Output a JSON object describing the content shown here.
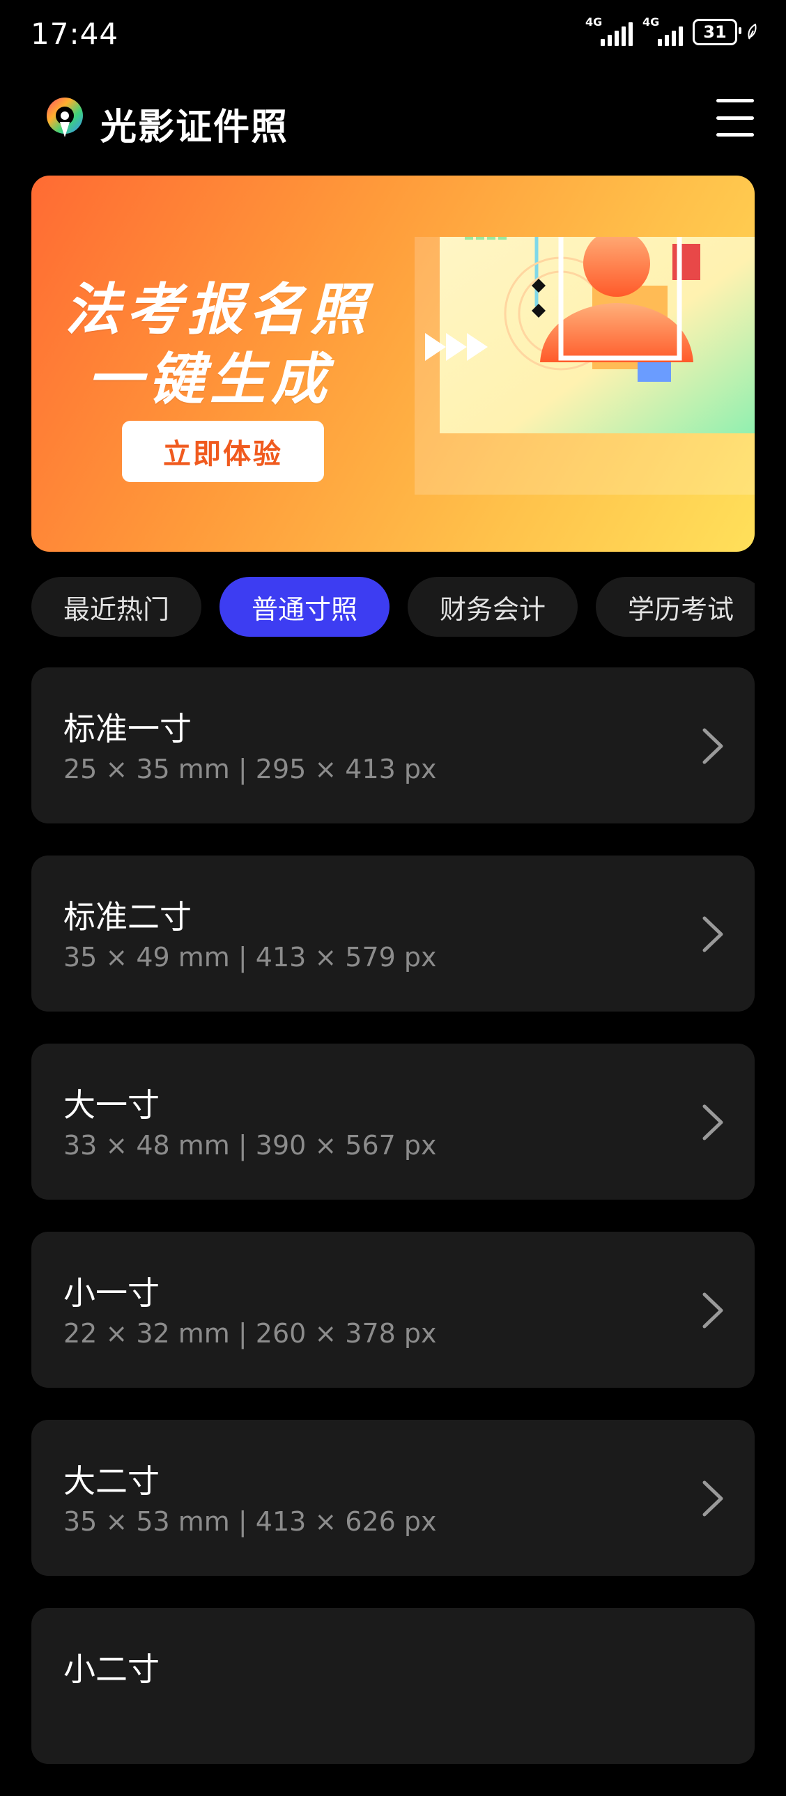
{
  "status": {
    "time": "17:44",
    "net1": "4G",
    "net2": "4G",
    "battery": "31"
  },
  "app": {
    "title": "光影证件照",
    "logo_icon": "aperture-pin-logo",
    "menu_icon": "hamburger-menu-icon"
  },
  "banner": {
    "line1": "法考报名照",
    "line2": "一键生成",
    "cta": "立即体验"
  },
  "tabs": [
    {
      "label": "最近热门",
      "active": false
    },
    {
      "label": "普通寸照",
      "active": true
    },
    {
      "label": "财务会计",
      "active": false
    },
    {
      "label": "学历考试",
      "active": false
    }
  ],
  "items": [
    {
      "title": "标准一寸",
      "spec": "25 × 35 mm | 295 × 413 px"
    },
    {
      "title": "标准二寸",
      "spec": "35 × 49 mm | 413 × 579 px"
    },
    {
      "title": "大一寸",
      "spec": "33 × 48 mm | 390 × 567 px"
    },
    {
      "title": "小一寸",
      "spec": "22 × 32 mm | 260 × 378 px"
    },
    {
      "title": "大二寸",
      "spec": "35 × 53 mm | 413 × 626 px"
    },
    {
      "title": "小二寸",
      "spec": ""
    }
  ],
  "colors": {
    "background": "#000000",
    "card": "#1b1b1b",
    "accent": "#3d3df2",
    "banner_cta_text": "#f05a1e"
  }
}
